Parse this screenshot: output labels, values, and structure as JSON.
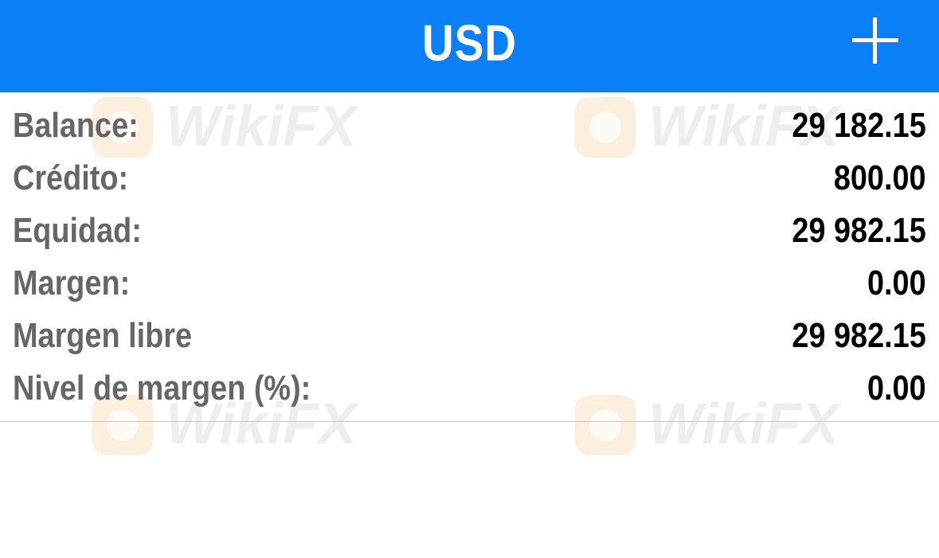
{
  "header": {
    "title": "USD",
    "add_icon": "plus-icon"
  },
  "watermark": {
    "text": "WikiFX"
  },
  "account": {
    "rows": [
      {
        "label": "Balance:",
        "value": "29 182.15"
      },
      {
        "label": "Crédito:",
        "value": "800.00"
      },
      {
        "label": "Equidad:",
        "value": "29 982.15"
      },
      {
        "label": "Margen:",
        "value": "0.00"
      },
      {
        "label": "Margen libre",
        "value": "29 982.15"
      },
      {
        "label": "Nivel de margen (%):",
        "value": "0.00"
      }
    ]
  },
  "colors": {
    "header_bg": "#0a7ff6",
    "label_text": "#666666",
    "value_text": "#000000"
  }
}
